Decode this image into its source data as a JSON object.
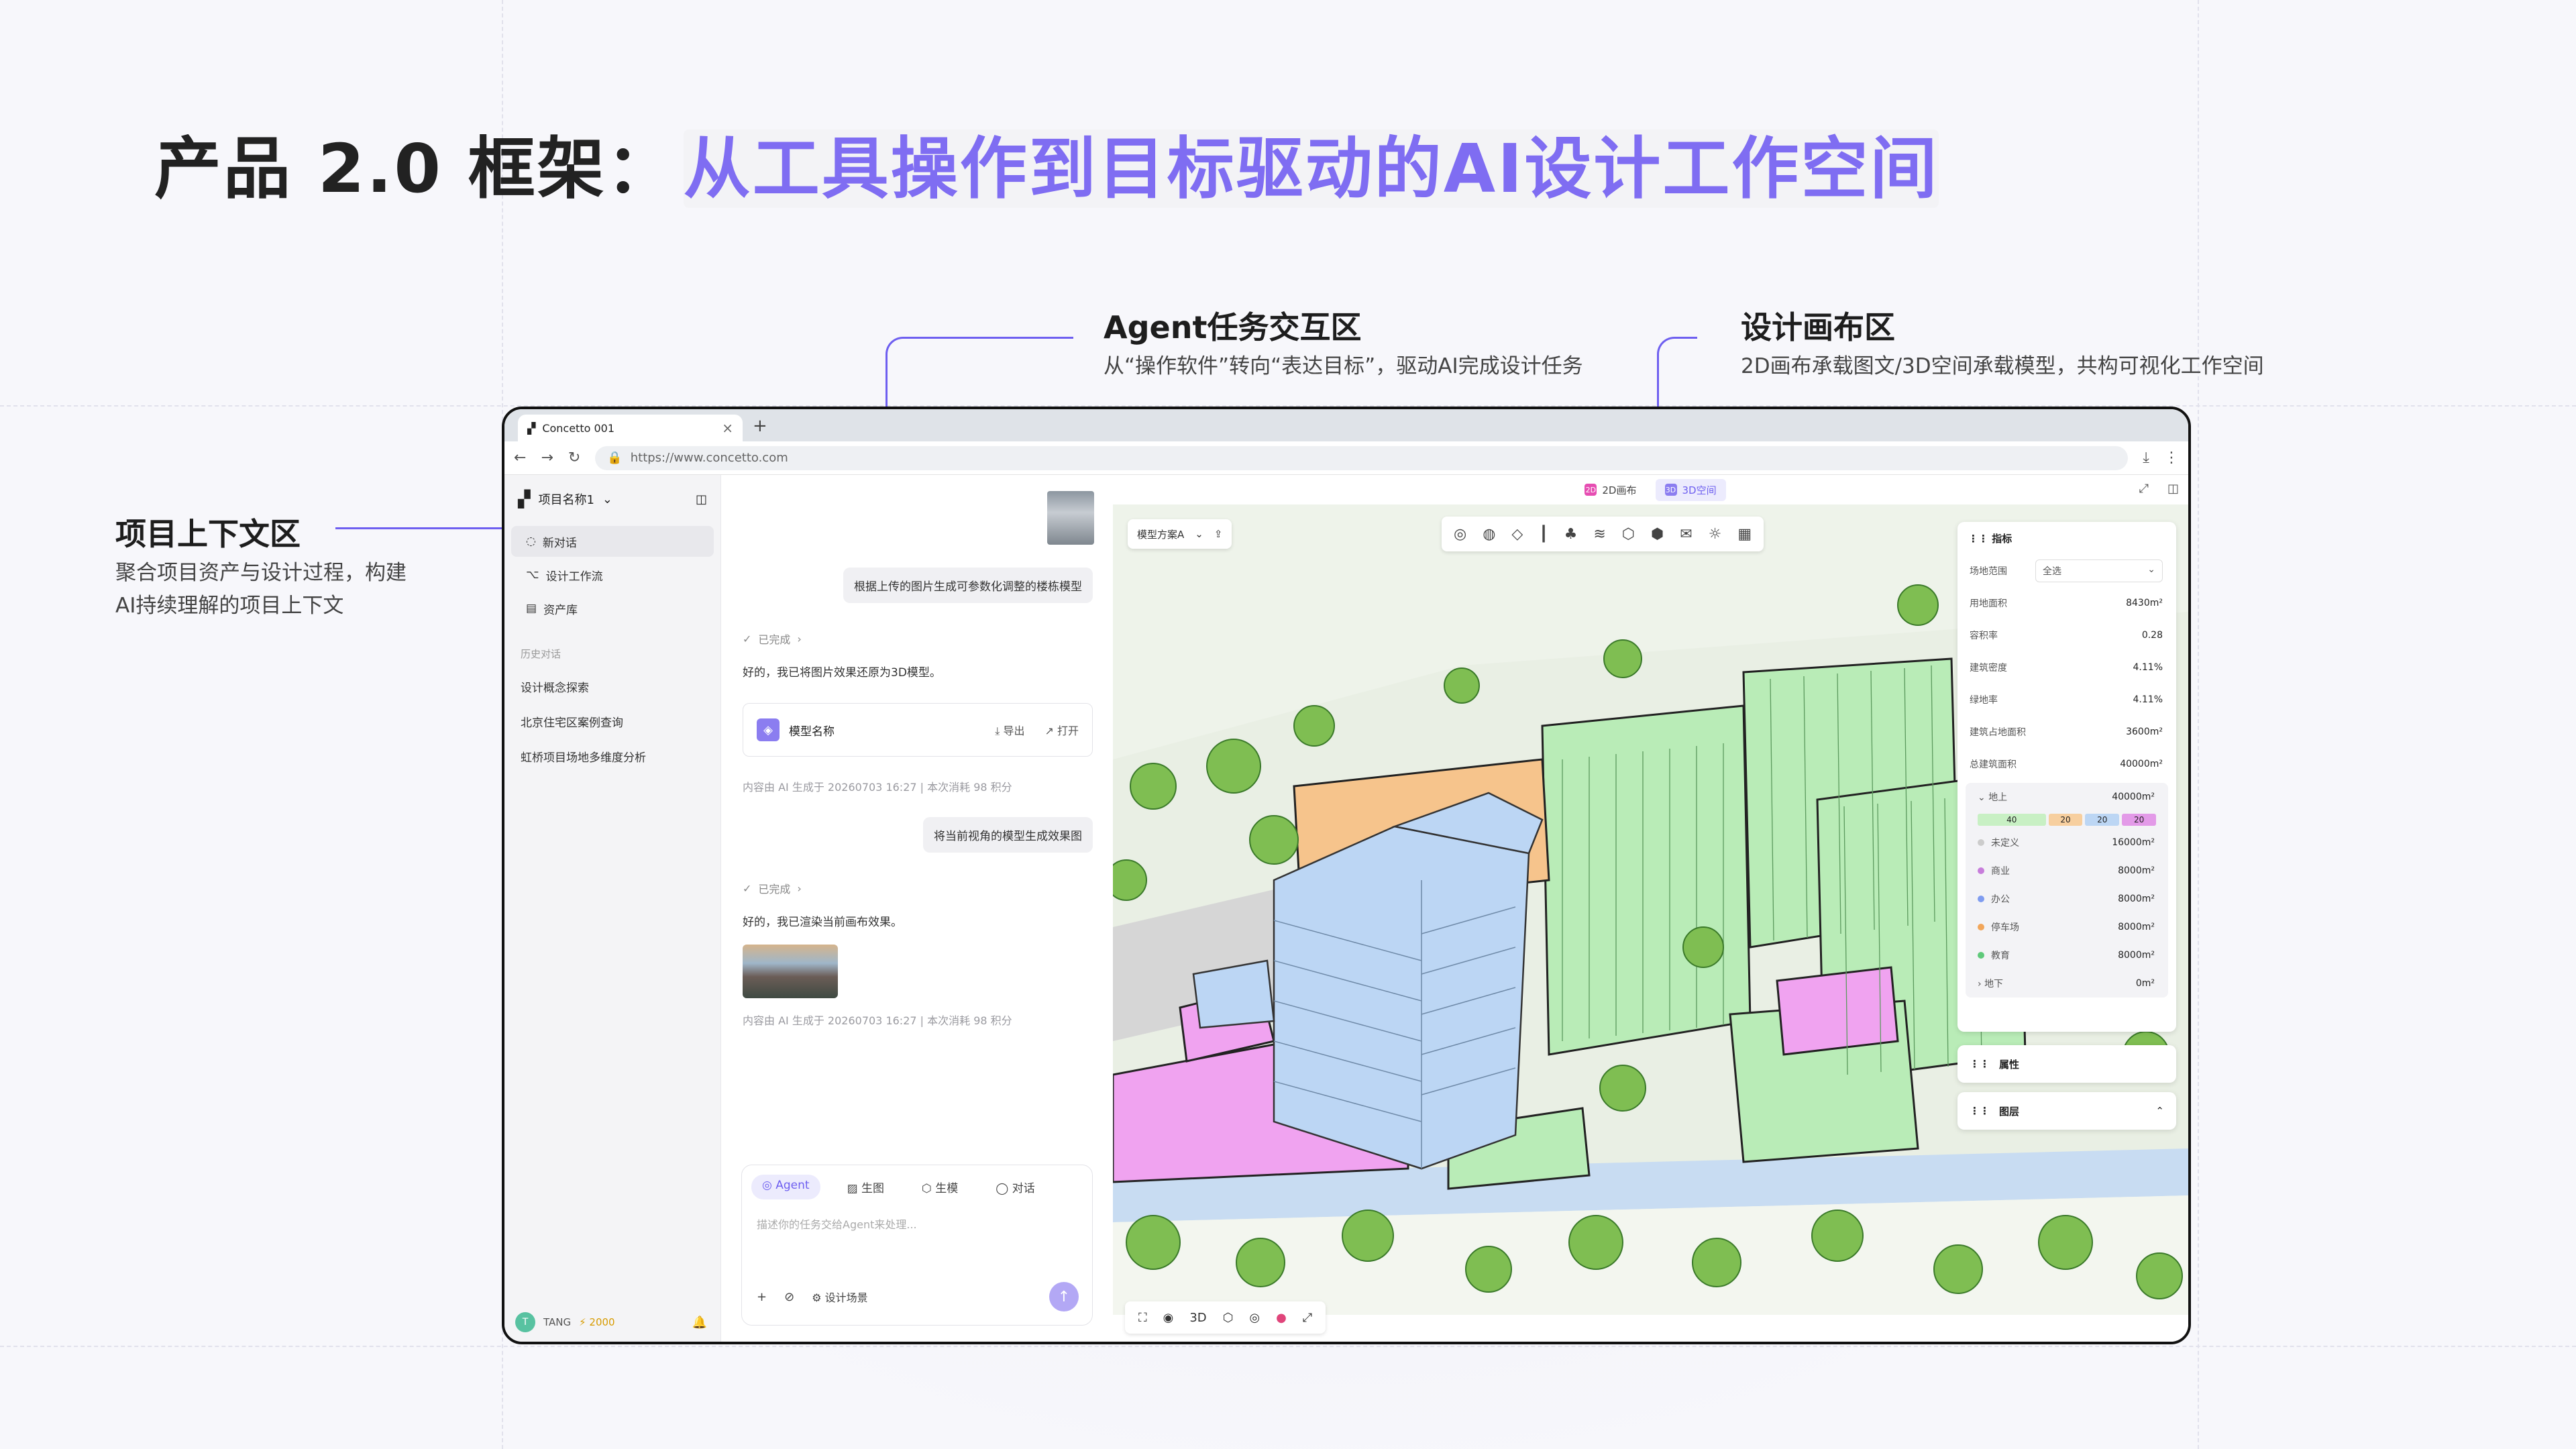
{
  "title": {
    "main": "产品 2.0 框架：",
    "accent": "从工具操作到目标驱动的AI设计工作空间"
  },
  "annotations": {
    "context": {
      "title": "项目上下文区",
      "desc1": "聚合项目资产与设计过程，构建",
      "desc2": "AI持续理解的项目上下文"
    },
    "agent": {
      "title": "Agent任务交互区",
      "desc": "从“操作软件”转向“表达目标”，驱动AI完成设计任务"
    },
    "canvas": {
      "title": "设计画布区",
      "desc": "2D画布承载图文/3D空间承载模型，共构可视化工作空间"
    }
  },
  "browser": {
    "tab_title": "Concetto 001",
    "url": "https://www.concetto.com"
  },
  "sidebar": {
    "project": "项目名称1",
    "items": [
      {
        "label": "新对话",
        "icon": "chat-icon"
      },
      {
        "label": "设计工作流",
        "icon": "workflow-icon"
      },
      {
        "label": "资产库",
        "icon": "library-icon"
      }
    ],
    "history_label": "历史对话",
    "history": [
      "设计概念探索",
      "北京住宅区案例查询",
      "虹桥项目场地多维度分析"
    ],
    "user": "TANG",
    "credits": "2000"
  },
  "chat": {
    "msg1": "根据上传的图片生成可参数化调整的楼栋模型",
    "status_done": "已完成",
    "reply1": "好的，我已将图片效果还原为3D模型。",
    "card_name": "模型名称",
    "card_export": "导出",
    "card_open": "打开",
    "meta": "内容由 AI 生成于 20260703 16:27 | 本次消耗 98 积分",
    "msg2": "将当前视角的模型生成效果图",
    "reply2": "好的，我已渲染当前画布效果。",
    "modes": [
      "Agent",
      "生图",
      "生模",
      "对话"
    ],
    "placeholder": "描述你的任务交给Agent来处理...",
    "scene_btn": "设计场景"
  },
  "canvas": {
    "view_2d": "2D画布",
    "view_3d": "3D空间",
    "scheme": "模型方案A",
    "panel": {
      "title": "指标",
      "range_label": "场地范围",
      "range_value": "全选",
      "rows": [
        [
          "用地面积",
          "8430m²"
        ],
        [
          "容积率",
          "0.28"
        ],
        [
          "建筑密度",
          "4.11%"
        ],
        [
          "绿地率",
          "4.11%"
        ],
        [
          "建筑占地面积",
          "3600m²"
        ],
        [
          "总建筑面积",
          "40000m²"
        ]
      ],
      "above_label": "地上",
      "above_value": "40000m²",
      "bars": [
        "40",
        "20",
        "20",
        "20"
      ],
      "uses": [
        [
          "未定义",
          "16000m²",
          "#cccccc"
        ],
        [
          "商业",
          "8000m²",
          "#c77ddb"
        ],
        [
          "办公",
          "8000m²",
          "#7f9cf0"
        ],
        [
          "停车场",
          "8000m²",
          "#f2a65a"
        ],
        [
          "教育",
          "8000m²",
          "#5fc97a"
        ]
      ],
      "below_label": "地下",
      "below_value": "0m²"
    },
    "props": "属性",
    "layers": "图层",
    "mode3d": "3D"
  }
}
